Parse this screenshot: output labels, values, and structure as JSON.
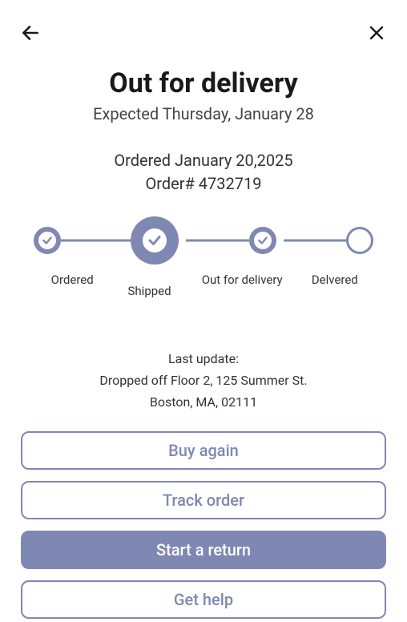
{
  "header": {
    "title": "Out for delivery",
    "expected": "Expected Thursday, January 28"
  },
  "order": {
    "date_line": "Ordered January 20,2025",
    "number_line": "Order# 4732719"
  },
  "tracker": {
    "steps": {
      "ordered": "Ordered",
      "shipped": "Shipped",
      "out_for_delivery": "Out for delivery",
      "delivered": "Delvered"
    }
  },
  "update": {
    "label": "Last update:",
    "line1": "Dropped off Floor 2, 125 Summer St.",
    "line2": "Boston, MA, 02111"
  },
  "actions": {
    "buy_again": "Buy again",
    "track_order": "Track order",
    "start_return": "Start a return",
    "get_help": "Get help"
  }
}
